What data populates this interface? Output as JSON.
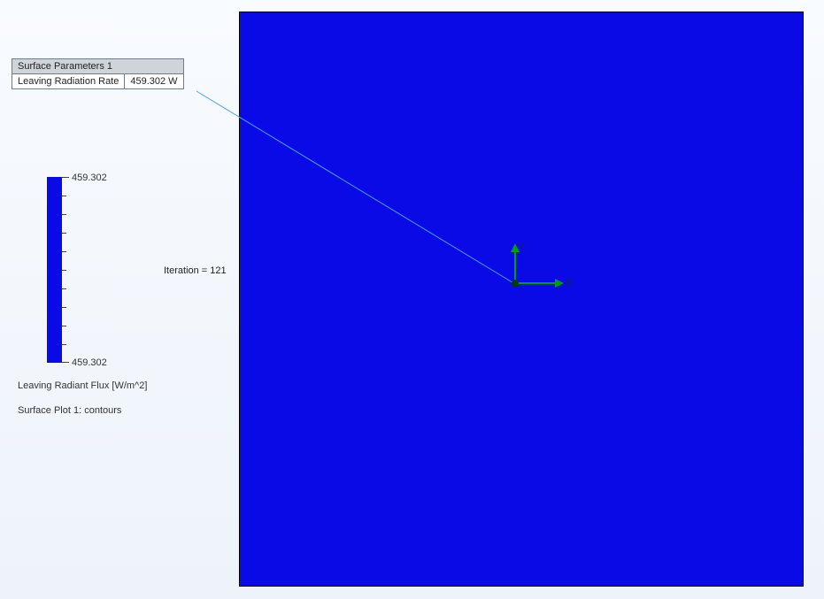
{
  "panel": {
    "title": "Surface Parameters 1",
    "param_label": "Leaving Radiation Rate",
    "param_value": "459.302 W"
  },
  "legend": {
    "top_value": "459.302",
    "bottom_value": "459.302",
    "caption1": "Leaving Radiant Flux [W/m^2]",
    "caption2": "Surface Plot 1: contours"
  },
  "iteration_text": "Iteration = 121",
  "axes": {
    "x_label": "X",
    "y_label": "Y"
  },
  "chart_data": {
    "type": "heatmap",
    "title": "Surface Plot 1: contours",
    "variable": "Leaving Radiant Flux [W/m^2]",
    "min": 459.302,
    "max": 459.302,
    "uniform_value": 459.302,
    "surface_parameters": [
      {
        "name": "Leaving Radiation Rate",
        "value": 459.302,
        "unit": "W"
      }
    ],
    "iteration": 121
  }
}
